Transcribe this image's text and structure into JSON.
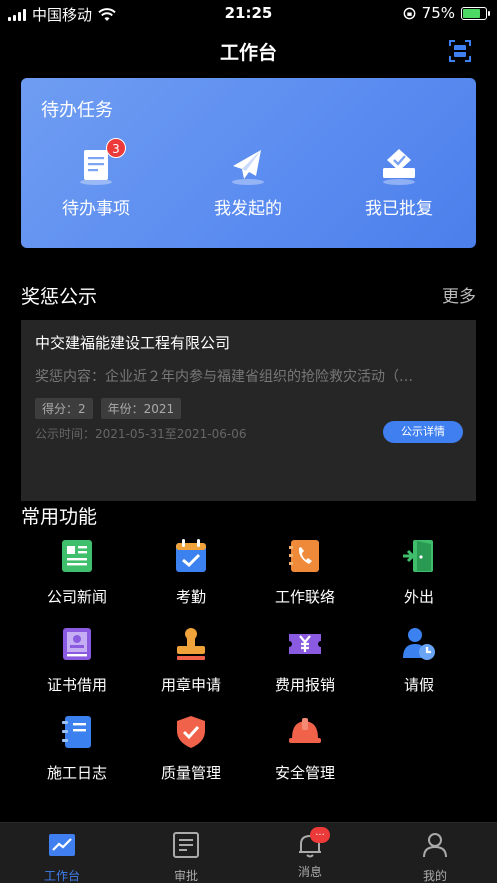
{
  "status": {
    "carrier": "中国移动",
    "time": "21:25",
    "battery": "75%",
    "battery_level": 0.75
  },
  "nav": {
    "title": "工作台"
  },
  "todo": {
    "title": "待办任务",
    "items": [
      {
        "label": "待办事项",
        "icon": "document-icon",
        "badge": "3"
      },
      {
        "label": "我发起的",
        "icon": "paper-plane-icon"
      },
      {
        "label": "我已批复",
        "icon": "ballot-box-icon"
      }
    ]
  },
  "rewards": {
    "title": "奖惩公示",
    "more": "更多",
    "card": {
      "company": "中交建福能建设工程有限公司",
      "content": "奖惩内容：企业近２年内参与福建省组织的抢险救灾活动（…",
      "score": "得分：2",
      "year": "年份：2021",
      "time": "公示时间：2021-05-31至2021-06-06",
      "detail_button": "公示详情"
    }
  },
  "functions": {
    "title": "常用功能",
    "items": [
      {
        "label": "公司新闻",
        "icon": "newspaper-icon",
        "color": "#3fbf6b"
      },
      {
        "label": "考勤",
        "icon": "calendar-check-icon",
        "color": "#3b82f0"
      },
      {
        "label": "工作联络",
        "icon": "phone-book-icon",
        "color": "#f08a3b"
      },
      {
        "label": "外出",
        "icon": "exit-door-icon",
        "color": "#3fbf6b"
      },
      {
        "label": "证书借用",
        "icon": "certificate-icon",
        "color": "#8a5be0"
      },
      {
        "label": "用章申请",
        "icon": "stamp-icon",
        "color": "#f0a23b"
      },
      {
        "label": "费用报销",
        "icon": "ticket-yen-icon",
        "color": "#8a5be0"
      },
      {
        "label": "请假",
        "icon": "person-clock-icon",
        "color": "#3b82f0"
      },
      {
        "label": "施工日志",
        "icon": "notebook-icon",
        "color": "#3b82f0"
      },
      {
        "label": "质量管理",
        "icon": "shield-check-icon",
        "color": "#f0624a"
      },
      {
        "label": "安全管理",
        "icon": "hard-hat-icon",
        "color": "#f0624a"
      }
    ]
  },
  "tabs": [
    {
      "label": "工作台",
      "icon": "chart-line-icon",
      "active": true
    },
    {
      "label": "审批",
      "icon": "document-list-icon"
    },
    {
      "label": "消息",
      "icon": "bell-icon",
      "badge": "..."
    },
    {
      "label": "我的",
      "icon": "user-icon"
    }
  ]
}
